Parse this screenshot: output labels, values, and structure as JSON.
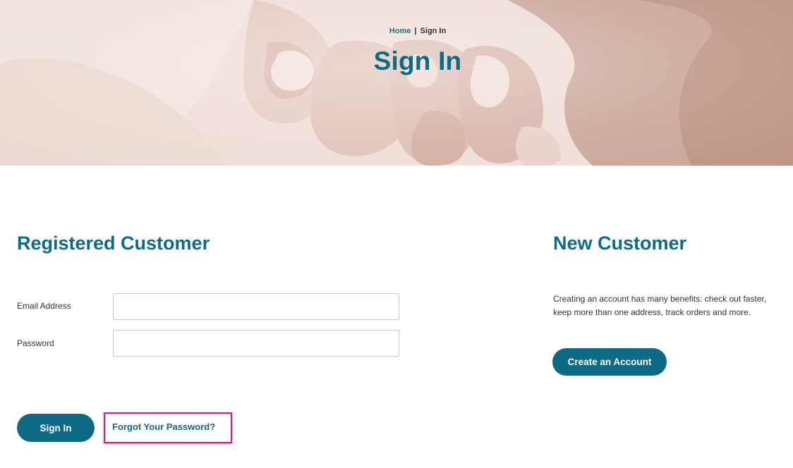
{
  "hero": {
    "breadcrumb": {
      "home_label": "Home",
      "separator": "|",
      "current_label": "Sign In"
    },
    "title": "Sign In"
  },
  "registered": {
    "title": "Registered Customer",
    "email_label": "Email Address",
    "email_value": "",
    "password_label": "Password",
    "password_value": "",
    "signin_label": "Sign In",
    "forgot_label": "Forgot Your Password?"
  },
  "new_customer": {
    "title": "New Customer",
    "description": "Creating an account has many benefits: check out faster, keep more than one address, track orders and more.",
    "create_label": "Create an Account"
  },
  "colors": {
    "brand": "#0f6a86",
    "highlight": "#e6127e"
  }
}
